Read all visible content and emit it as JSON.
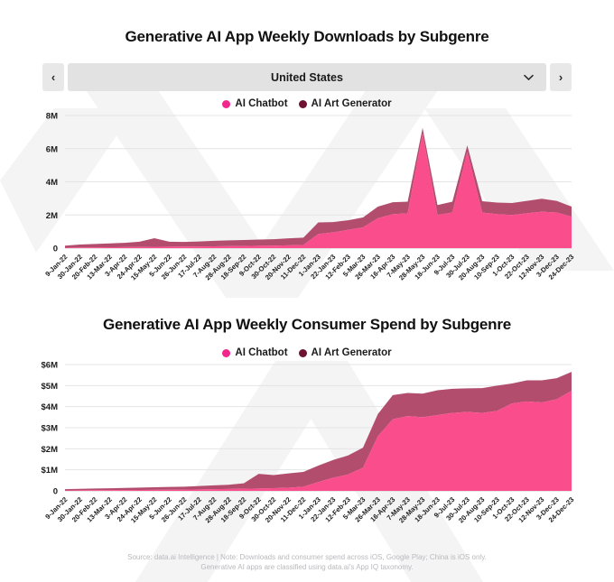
{
  "chart_data": [
    {
      "type": "area",
      "stacked": true,
      "title": "Generative AI App Weekly Downloads by Subgenre",
      "xlabel": "",
      "ylabel": "",
      "ylim": [
        0,
        8000000
      ],
      "ytick_labels": [
        "0",
        "2M",
        "4M",
        "6M",
        "8M"
      ],
      "ytick_values": [
        0,
        2000000,
        4000000,
        6000000,
        8000000
      ],
      "grid": true,
      "legend_position": "top-center",
      "x": [
        "9-Jan-22",
        "30-Jan-22",
        "20-Feb-22",
        "13-Mar-22",
        "3-Apr-22",
        "24-Apr-22",
        "15-May-22",
        "5-Jun-22",
        "26-Jun-22",
        "17-Jul-22",
        "7-Aug-22",
        "28-Aug-22",
        "18-Sep-22",
        "9-Oct-22",
        "30-Oct-22",
        "20-Nov-22",
        "11-Dec-22",
        "1-Jan-23",
        "22-Jan-23",
        "12-Feb-23",
        "5-Mar-23",
        "26-Mar-23",
        "16-Apr-23",
        "7-May-23",
        "28-May-23",
        "18-Jun-23",
        "9-Jul-23",
        "30-Jul-23",
        "20-Aug-23",
        "10-Sep-23",
        "1-Oct-23",
        "22-Oct-23",
        "12-Nov-23",
        "3-Dec-23",
        "24-Dec-23"
      ],
      "series": [
        {
          "name": "AI Chatbot",
          "color": "#FA4E8C",
          "values": [
            30000,
            40000,
            50000,
            55000,
            60000,
            70000,
            80000,
            90000,
            95000,
            100000,
            110000,
            120000,
            130000,
            140000,
            150000,
            170000,
            190000,
            850000,
            950000,
            1100000,
            1250000,
            1800000,
            2050000,
            2100000,
            6900000,
            2000000,
            2150000,
            5800000,
            2150000,
            2050000,
            2000000,
            2100000,
            2200000,
            2150000,
            1900000
          ]
        },
        {
          "name": "AI Art Generator",
          "color": "#B24D6E",
          "values": [
            120000,
            180000,
            200000,
            230000,
            260000,
            320000,
            520000,
            300000,
            280000,
            300000,
            330000,
            350000,
            360000,
            380000,
            390000,
            420000,
            440000,
            700000,
            620000,
            580000,
            600000,
            700000,
            720000,
            700000,
            350000,
            600000,
            650000,
            400000,
            680000,
            700000,
            720000,
            750000,
            780000,
            700000,
            600000
          ]
        }
      ],
      "annotations": {
        "peak_1": {
          "x": "28-May-23",
          "total": 7250000
        },
        "peak_2": {
          "x": "30-Jul-23",
          "total": 6200000
        }
      }
    },
    {
      "type": "area",
      "stacked": true,
      "title": "Generative AI App Weekly Consumer Spend by Subgenre",
      "xlabel": "",
      "ylabel": "",
      "ylim": [
        0,
        6000000
      ],
      "ytick_labels": [
        "0",
        "$1M",
        "$2M",
        "$3M",
        "$4M",
        "$5M",
        "$6M"
      ],
      "ytick_values": [
        0,
        1000000,
        2000000,
        3000000,
        4000000,
        5000000,
        6000000
      ],
      "grid": true,
      "legend_position": "top-center",
      "x": [
        "9-Jan-22",
        "30-Jan-22",
        "20-Feb-22",
        "13-Mar-22",
        "3-Apr-22",
        "24-Apr-22",
        "15-May-22",
        "5-Jun-22",
        "26-Jun-22",
        "17-Jul-22",
        "7-Aug-22",
        "28-Aug-22",
        "18-Sep-22",
        "9-Oct-22",
        "30-Oct-22",
        "20-Nov-22",
        "11-Dec-22",
        "1-Jan-23",
        "22-Jan-23",
        "12-Feb-23",
        "5-Mar-23",
        "26-Mar-23",
        "16-Apr-23",
        "7-May-23",
        "28-May-23",
        "18-Jun-23",
        "9-Jul-23",
        "30-Jul-23",
        "20-Aug-23",
        "10-Sep-23",
        "1-Oct-23",
        "22-Oct-23",
        "12-Nov-23",
        "3-Dec-23",
        "24-Dec-23"
      ],
      "series": [
        {
          "name": "AI Chatbot",
          "color": "#FA4E8C",
          "values": [
            20000,
            25000,
            30000,
            35000,
            40000,
            45000,
            50000,
            55000,
            60000,
            70000,
            80000,
            90000,
            100000,
            110000,
            130000,
            150000,
            200000,
            420000,
            620000,
            780000,
            1100000,
            2600000,
            3400000,
            3550000,
            3500000,
            3600000,
            3700000,
            3750000,
            3700000,
            3800000,
            4150000,
            4250000,
            4200000,
            4350000,
            4750000
          ]
        },
        {
          "name": "AI Art Generator",
          "color": "#B24D6E",
          "values": [
            60000,
            70000,
            80000,
            90000,
            100000,
            110000,
            120000,
            130000,
            140000,
            160000,
            180000,
            200000,
            260000,
            700000,
            620000,
            680000,
            700000,
            780000,
            850000,
            900000,
            950000,
            1050000,
            1150000,
            1100000,
            1120000,
            1180000,
            1150000,
            1120000,
            1180000,
            1200000,
            950000,
            1000000,
            1050000,
            1000000,
            900000
          ]
        }
      ]
    }
  ],
  "header": {
    "title_downloads": "Generative AI App Weekly Downloads by Subgenre",
    "title_spend": "Generative AI App Weekly Consumer Spend by Subgenre"
  },
  "selector": {
    "prev_label": "‹",
    "next_label": "›",
    "value": "United States",
    "chevron_icon": "chevron-down-icon"
  },
  "legend": {
    "items": [
      {
        "label": "AI Chatbot",
        "color": "#F2268B"
      },
      {
        "label": "AI Art Generator",
        "color": "#6E1230"
      }
    ]
  },
  "footer": {
    "line1": "Source: data.ai Intelligence | Note: Downloads and consumer spend across iOS, Google Play; China is iOS only.",
    "line2": "Generative AI apps are classified using data.ai's App IQ taxonomy."
  }
}
